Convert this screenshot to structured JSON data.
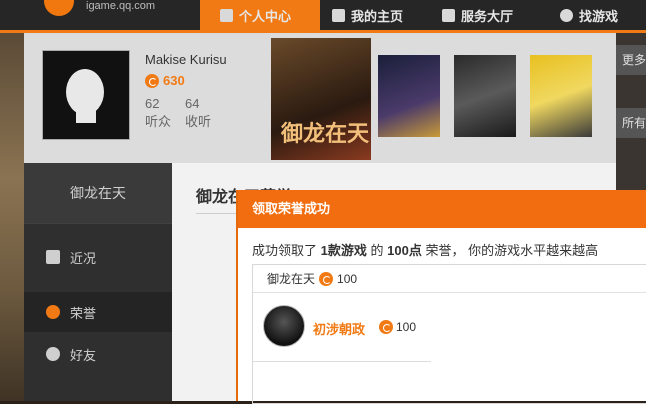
{
  "brand": {
    "logo_text": "igame.qq.com",
    "accent": "#f27a14"
  },
  "nav": {
    "items": [
      {
        "label": "个人中心",
        "active": true
      },
      {
        "label": "我的主页"
      },
      {
        "label": "服务大厅"
      },
      {
        "label": "找游戏"
      }
    ]
  },
  "profile": {
    "username": "Makise Kurisu",
    "points": "630",
    "fans_count": "62",
    "fans_label": "听众",
    "collect_count": "64",
    "collect_label": "收听",
    "right_buttons": [
      "更多",
      "所有"
    ]
  },
  "sidebar": {
    "title": "御龙在天",
    "items": [
      {
        "label": "近况",
        "icon": "home-icon"
      },
      {
        "label": "荣誉",
        "icon": "honor-coin-icon",
        "active": true
      },
      {
        "label": "好友",
        "icon": "friends-icon"
      }
    ]
  },
  "main": {
    "title": "御龙在天荣誉"
  },
  "dialog": {
    "title": "领取荣誉成功",
    "msg_prefix": "成功领取了",
    "msg_games": "1款游戏",
    "msg_of": "的",
    "msg_points": "100点",
    "msg_honor": "荣誉，",
    "msg_suffix": "你的游戏水平越来越高",
    "game_name": "御龙在天",
    "game_points": "100",
    "achievement_name": "初涉朝政",
    "achievement_points": "100"
  }
}
